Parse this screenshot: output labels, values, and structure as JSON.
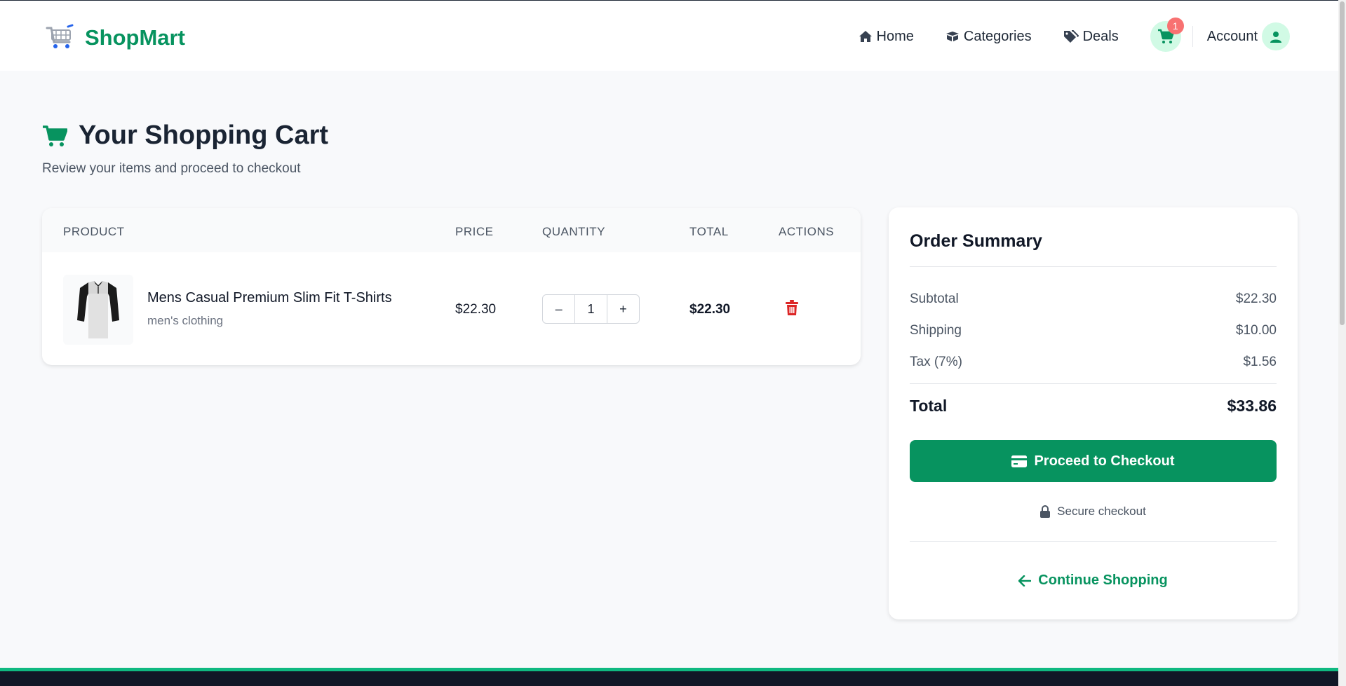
{
  "brand": {
    "name": "ShopMart"
  },
  "nav": {
    "home": "Home",
    "categories": "Categories",
    "deals": "Deals",
    "cart_count": "1",
    "account": "Account"
  },
  "page": {
    "title": "Your Shopping Cart",
    "subtitle": "Review your items and proceed to checkout"
  },
  "cart": {
    "columns": [
      "PRODUCT",
      "PRICE",
      "QUANTITY",
      "TOTAL",
      "ACTIONS"
    ],
    "items": [
      {
        "name": "Mens Casual Premium Slim Fit T-Shirts",
        "category": "men's clothing",
        "price": "$22.30",
        "quantity": "1",
        "total": "$22.30"
      }
    ],
    "qty_minus": "–",
    "qty_plus": "+"
  },
  "summary": {
    "title": "Order Summary",
    "subtotal_label": "Subtotal",
    "subtotal": "$22.30",
    "shipping_label": "Shipping",
    "shipping": "$10.00",
    "tax_label": "Tax (7%)",
    "tax": "$1.56",
    "total_label": "Total",
    "total": "$33.86",
    "checkout_label": "Proceed to Checkout",
    "secure_label": "Secure checkout",
    "continue_label": "Continue Shopping"
  },
  "colors": {
    "accent": "#07935f",
    "badge": "#f87171",
    "danger": "#dc2626"
  }
}
